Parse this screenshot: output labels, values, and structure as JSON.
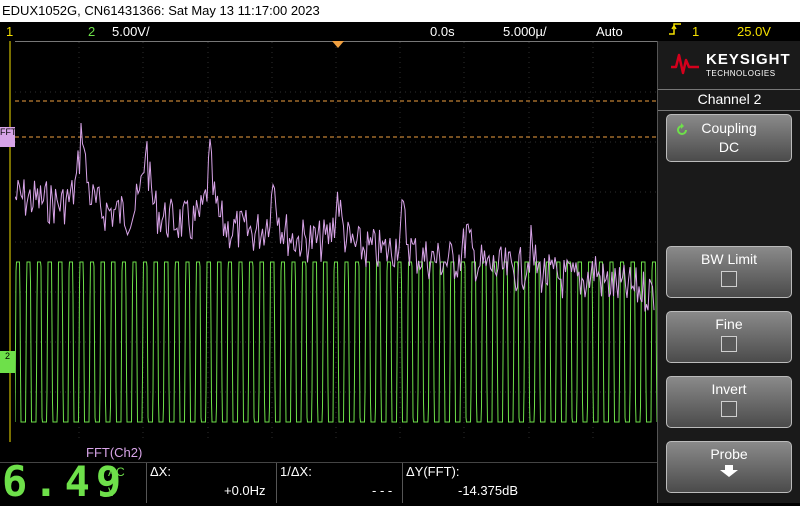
{
  "title_bar": "EDUX1052G, CN61431366: Sat May 13 11:17:00 2023",
  "status": {
    "ch1_num": "1",
    "ch2_num": "2",
    "ch2_scale": "5.00V/",
    "delay": "0.0s",
    "timebase": "5.000µ/",
    "trigger_mode": "Auto",
    "trigger_ch": "1",
    "trigger_level": "25.0V"
  },
  "markers": {
    "fft": "FFT",
    "ch2": "2"
  },
  "bottom": {
    "fft_label": "FFT(Ch2)",
    "voltage_value": "6.49",
    "voltage_ac": "AC",
    "voltage_unit": "V",
    "dx_label": "ΔX:",
    "dx_value": "+0.0Hz",
    "inv_dx_label": "1/ΔX:",
    "inv_dx_value": "- - -",
    "dy_label": "ΔY(FFT):",
    "dy_value": "-14.375dB"
  },
  "side": {
    "brand": "KEYSIGHT",
    "brand_sub": "TECHNOLOGIES",
    "menu_title": "Channel 2",
    "coupling_label": "Coupling",
    "coupling_value": "DC",
    "bw_limit_label": "BW Limit",
    "fine_label": "Fine",
    "invert_label": "Invert",
    "probe_label": "Probe"
  },
  "colors": {
    "ch1": "#f5e000",
    "ch2": "#6ee04a",
    "fft": "#d8a4e8",
    "cursor": "#f0a040",
    "brand_red": "#d4001c"
  }
}
